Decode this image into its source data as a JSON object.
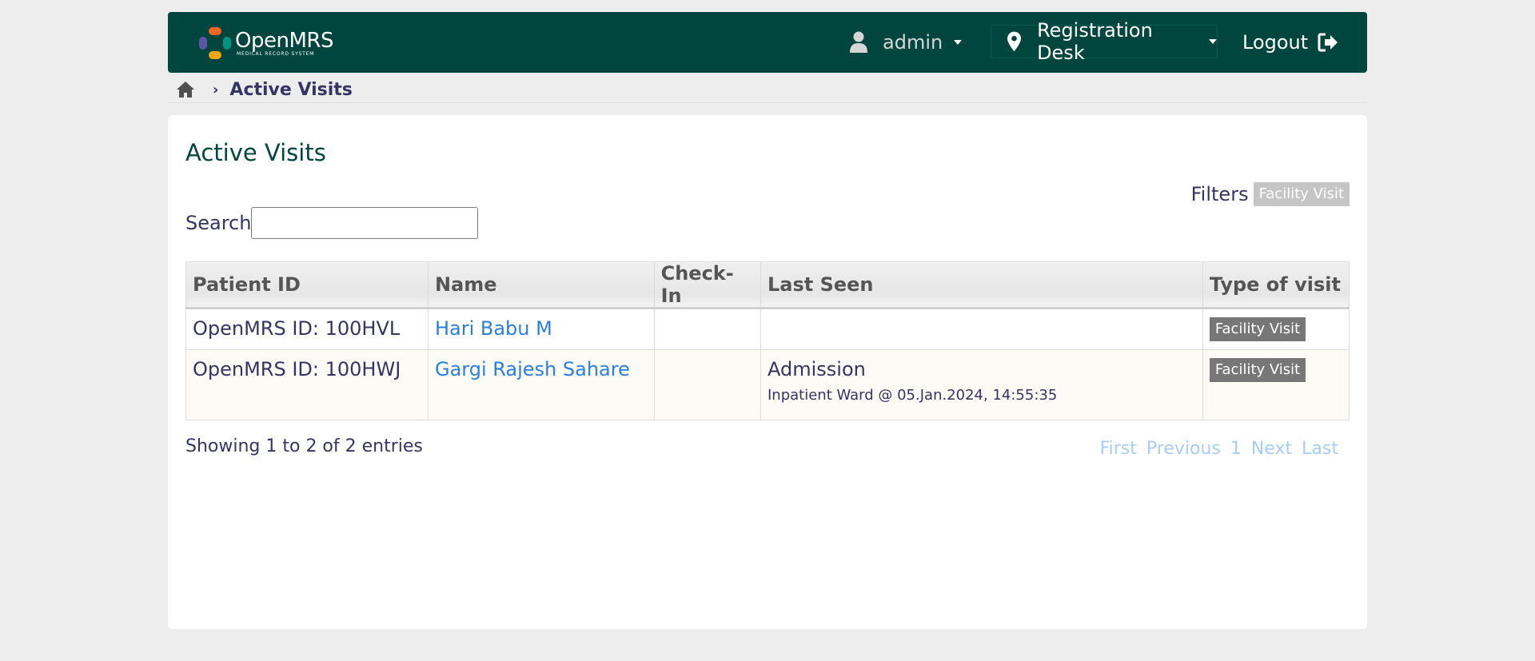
{
  "header": {
    "logo_name": "OpenMRS",
    "logo_tagline": "MEDICAL RECORD SYSTEM",
    "user": "admin",
    "location": "Registration Desk",
    "logout": "Logout"
  },
  "breadcrumb": {
    "current": "Active Visits"
  },
  "main": {
    "title": "Active Visits",
    "filters_label": "Filters",
    "filter_tag": "Facility Visit",
    "search_label": "Search",
    "search_value": "",
    "table": {
      "headers": [
        "Patient ID",
        "Name",
        "Check-In",
        "Last Seen",
        "Type of visit"
      ],
      "rows": [
        {
          "patient_id": "OpenMRS ID: 100HVL",
          "name": "Hari Babu M",
          "check_in": "",
          "last_seen": "",
          "last_seen_detail": "",
          "type": "Facility Visit"
        },
        {
          "patient_id": "OpenMRS ID: 100HWJ",
          "name": "Gargi Rajesh Sahare",
          "check_in": "",
          "last_seen": "Admission",
          "last_seen_detail": "Inpatient Ward @ 05.Jan.2024, 14:55:35",
          "type": "Facility Visit"
        }
      ]
    },
    "showing": "Showing 1 to 2 of 2 entries",
    "pagination": [
      "First",
      "Previous",
      "1",
      "Next",
      "Last"
    ]
  },
  "colors": {
    "header_bg": "#00463f",
    "link": "#2a7fe0",
    "badge_bg": "#777777",
    "filter_badge_bg": "#c5c5c5",
    "pager": "#a8cdf5"
  }
}
